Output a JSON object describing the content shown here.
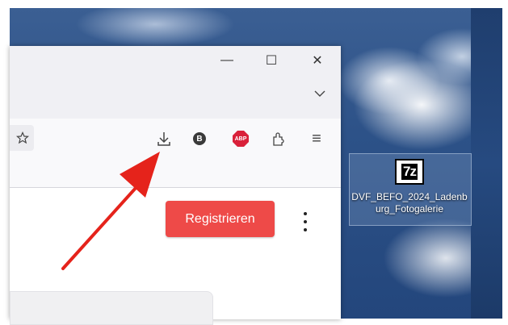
{
  "window": {
    "minimize_glyph": "—",
    "maximize_glyph": "☐",
    "close_glyph": "✕"
  },
  "toolbar": {
    "b_extension_label": "B",
    "abp_label": "ABP",
    "menu_glyph": "≡"
  },
  "page": {
    "register_label": "Registrieren"
  },
  "desktop": {
    "file_icon_text": "7z",
    "file_label": "DVF_BEFO_2024_Ladenburg_Fotogalerie"
  },
  "colors": {
    "accent_button": "#ee4a48",
    "annotation_arrow": "#e5231b",
    "abp_red": "#d9213a"
  },
  "icons": [
    "star-icon",
    "download-icon",
    "b-extension-icon",
    "abp-icon",
    "extensions-icon",
    "menu-icon",
    "chevron-down-icon",
    "7z-archive-icon"
  ]
}
